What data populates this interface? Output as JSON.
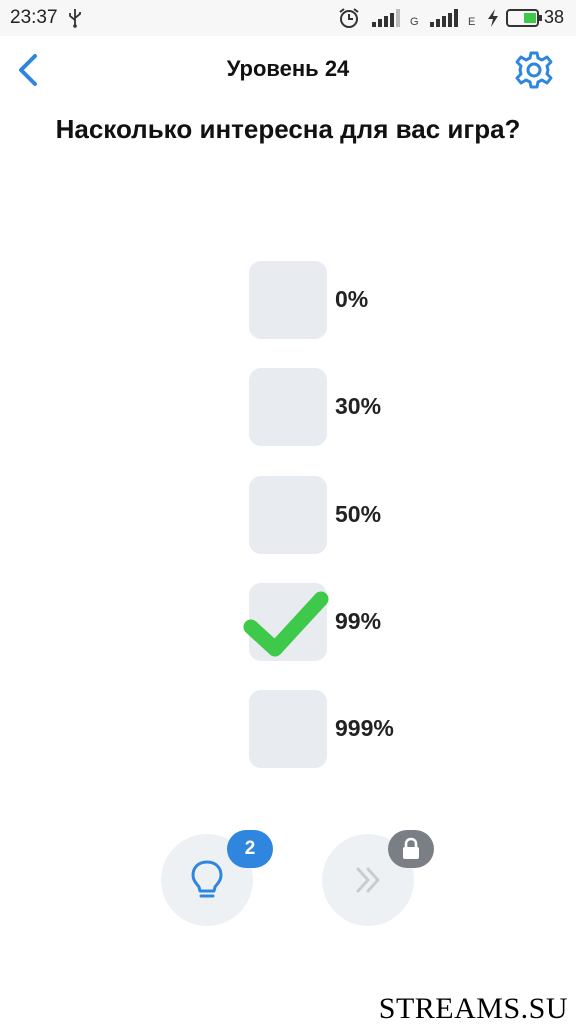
{
  "status_bar": {
    "time": "23:37",
    "net_type_1": "G",
    "net_type_2": "E",
    "battery": "38"
  },
  "header": {
    "title": "Уровень 24"
  },
  "question": "Насколько интересна для вас игра?",
  "options": [
    {
      "label": "0%",
      "checked": false
    },
    {
      "label": "30%",
      "checked": false
    },
    {
      "label": "50%",
      "checked": false
    },
    {
      "label": "99%",
      "checked": true
    },
    {
      "label": "999%",
      "checked": false
    }
  ],
  "bottom": {
    "hint_count": "2"
  },
  "icons": {
    "back": "chevron-left-icon",
    "settings": "gear-icon",
    "hint": "lightbulb-icon",
    "skip": "double-chevron-right-icon",
    "lock": "lock-icon"
  },
  "colors": {
    "accent": "#2e86de",
    "check": "#3ec94a",
    "option_box": "#e8ecf0",
    "button_bg": "#eef1f4",
    "lock_badge": "#7a7f86"
  },
  "watermark": "STREAMS.SU"
}
